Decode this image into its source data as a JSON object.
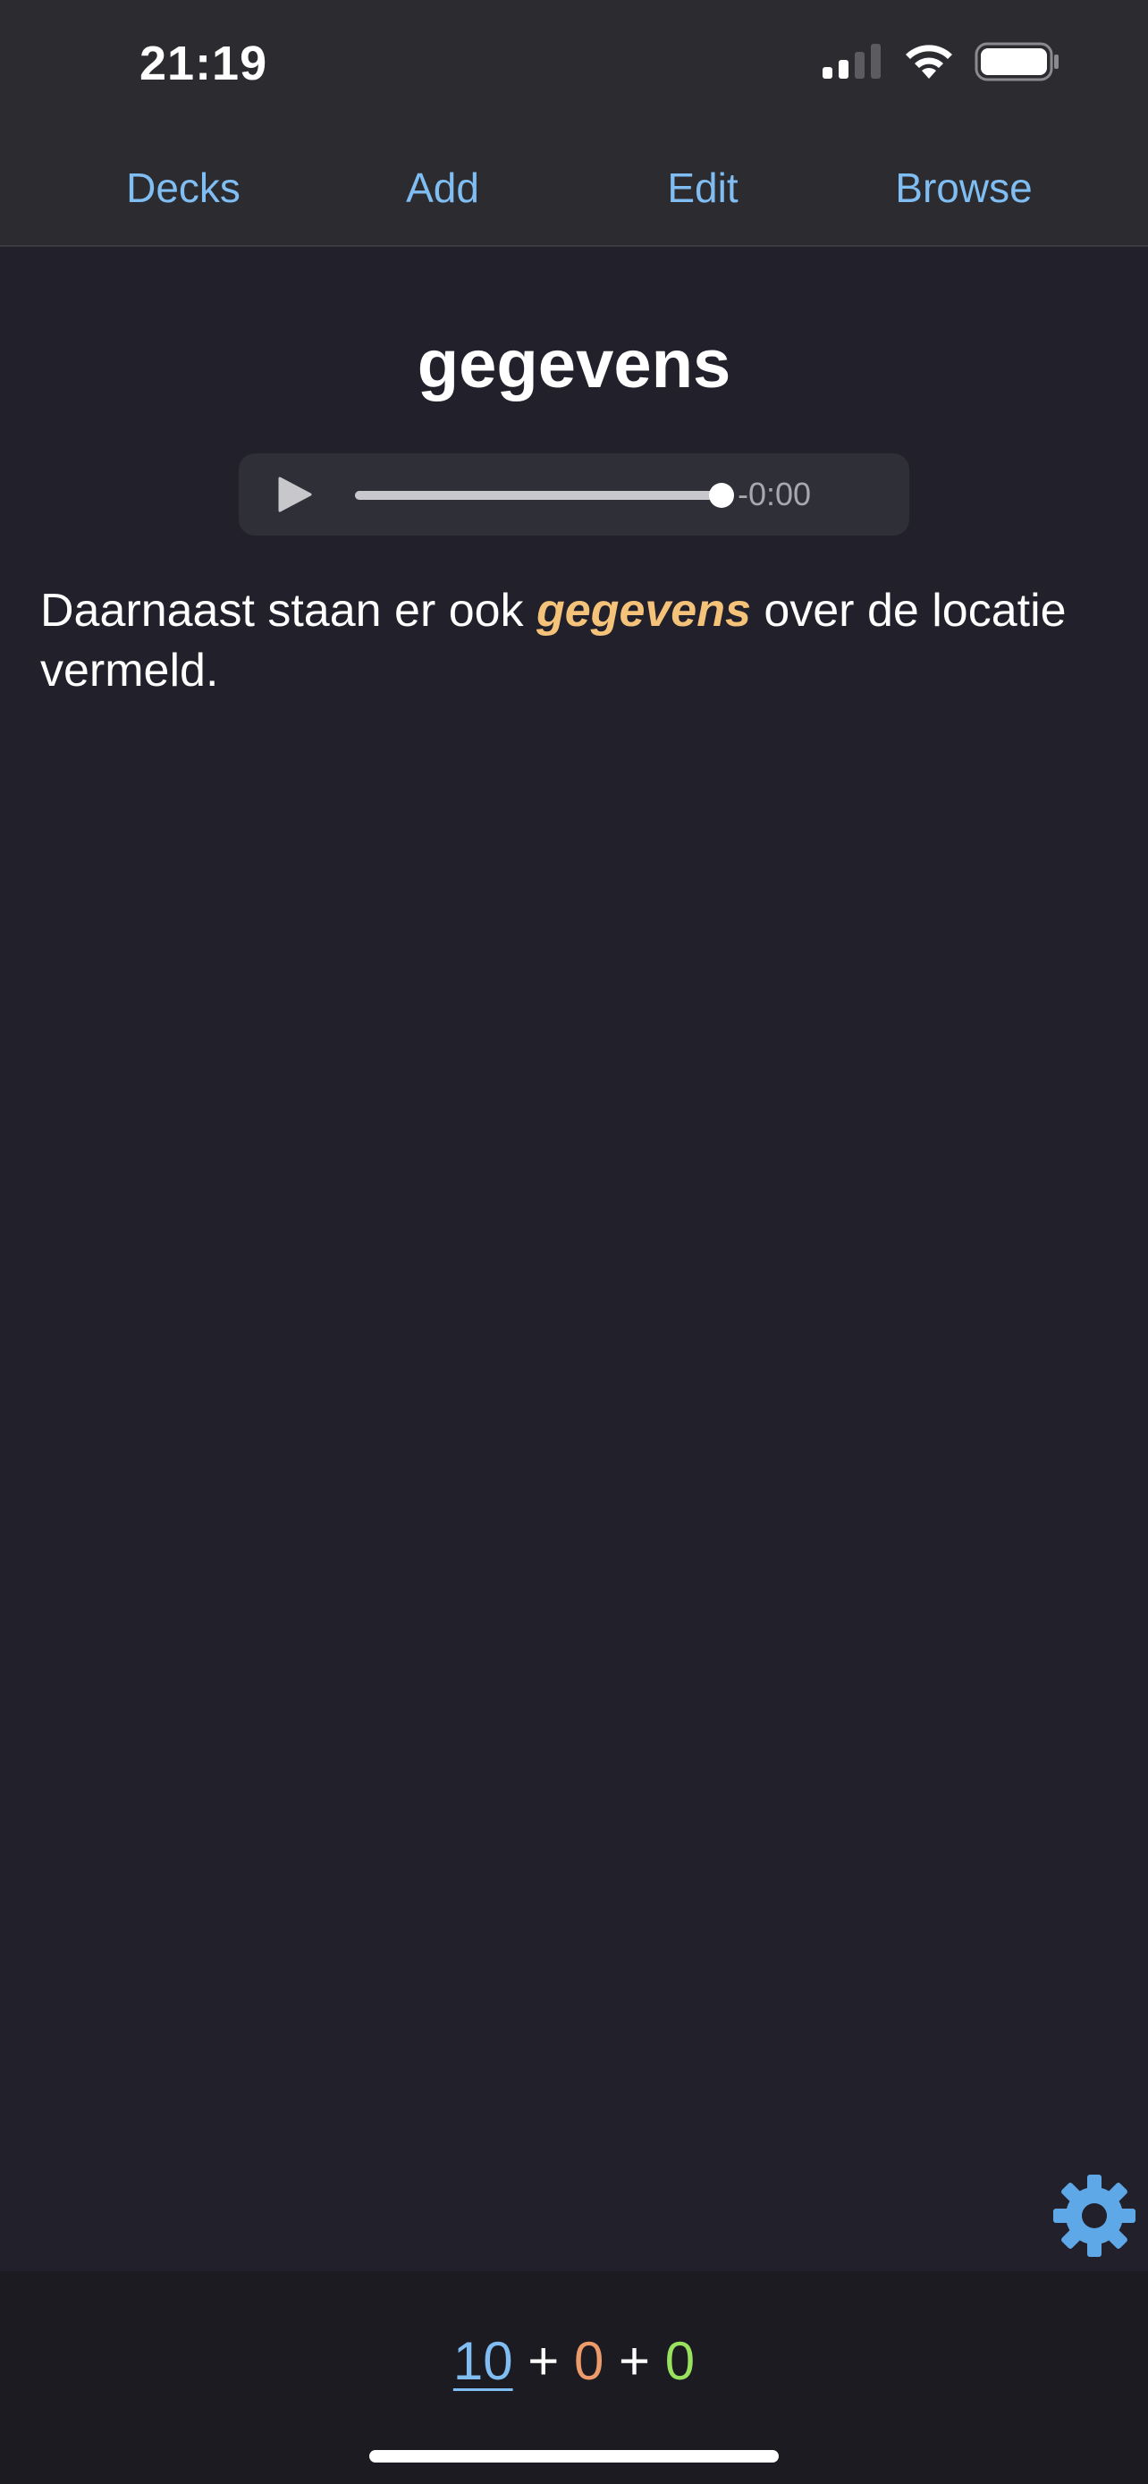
{
  "status_bar": {
    "time": "21:19"
  },
  "nav": {
    "decks": "Decks",
    "add": "Add",
    "edit": "Edit",
    "browse": "Browse",
    "color": "#80bdf2"
  },
  "card": {
    "word": "gegevens",
    "sentence_before": "Daarnaast staan er ook ",
    "sentence_highlight": "gegevens",
    "sentence_after": " over de locatie vermeld.",
    "highlight_color": "#f5c27a"
  },
  "audio": {
    "time_remaining": "-0:00",
    "progress": 1.0
  },
  "counts": {
    "new": "10",
    "learning": "0",
    "review": "0",
    "separator": "+",
    "colors": {
      "new": "#80bdf2",
      "learning": "#ee9b6c",
      "review": "#99e25d"
    }
  },
  "icons": {
    "settings": "gear-icon",
    "play": "play-icon"
  }
}
